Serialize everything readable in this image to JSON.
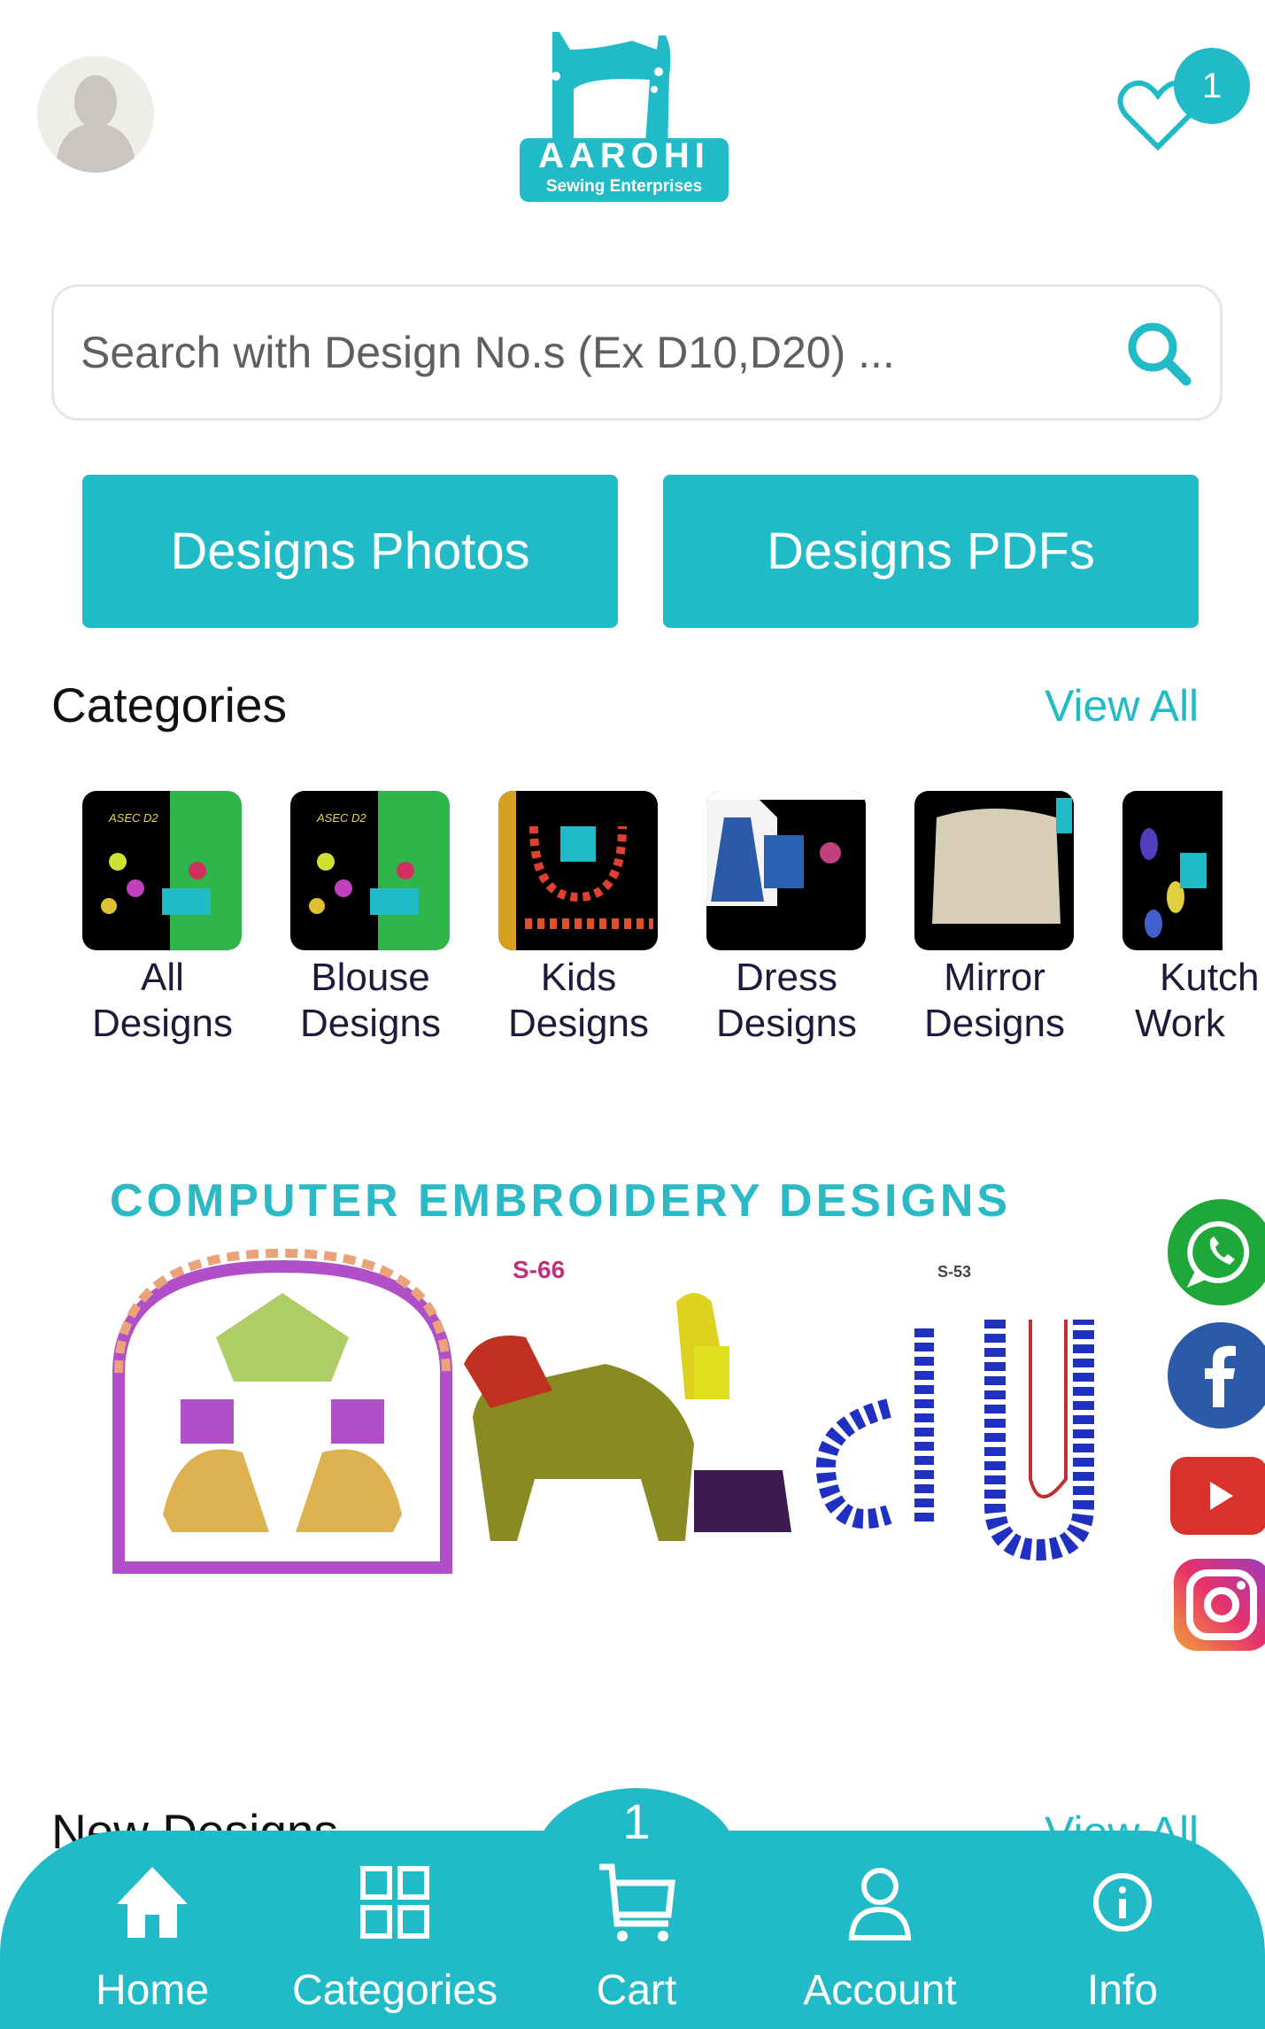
{
  "header": {
    "logo_title": "AAROHI",
    "logo_subtitle": "Sewing Enterprises",
    "wishlist_count": "1",
    "avatar_icon": "user-avatar-icon",
    "wishlist_icon": "heart-icon"
  },
  "search": {
    "placeholder": "Search with Design No.s (Ex D10,D20) ...",
    "value": "",
    "icon": "search-icon"
  },
  "buttons": {
    "photos": "Designs Photos",
    "pdfs": "Designs PDFs"
  },
  "categories": {
    "title": "Categories",
    "view_all": "View All",
    "items": [
      {
        "line1": "All",
        "line2": "Designs"
      },
      {
        "line1": "Blouse",
        "line2": "Designs"
      },
      {
        "line1": "Kids",
        "line2": "Designs"
      },
      {
        "line1": "Dress",
        "line2": "Designs"
      },
      {
        "line1": "Mirror",
        "line2": "Designs"
      },
      {
        "line1": "Kutch",
        "line2": "Work"
      }
    ]
  },
  "banner": {
    "title": "COMPUTER EMBROIDERY DESIGNS",
    "label_1": "S-66",
    "label_2": "S-53"
  },
  "social": [
    "whatsapp-icon",
    "facebook-icon",
    "youtube-icon",
    "instagram-icon"
  ],
  "new_designs": {
    "title": "New Designs",
    "view_all": "View All"
  },
  "nav": {
    "cart_count": "1",
    "items": [
      {
        "label": "Home",
        "icon": "home-icon"
      },
      {
        "label": "Categories",
        "icon": "grid-icon"
      },
      {
        "label": "Cart",
        "icon": "cart-icon"
      },
      {
        "label": "Account",
        "icon": "user-icon"
      },
      {
        "label": "Info",
        "icon": "info-icon"
      }
    ]
  },
  "colors": {
    "accent": "#21bbc8",
    "text": "#111111"
  }
}
